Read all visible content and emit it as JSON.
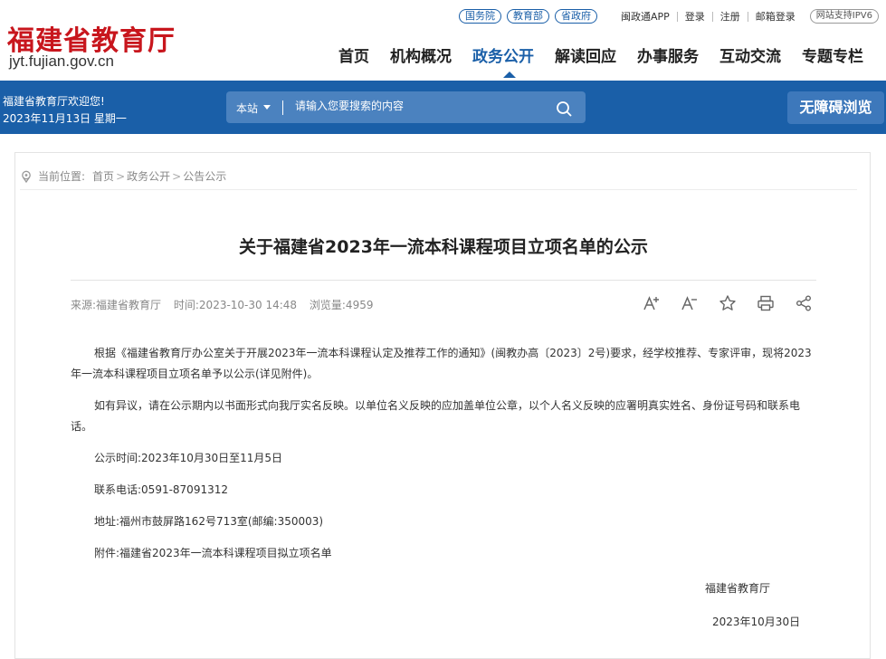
{
  "header": {
    "logo_title": "福建省教育厅",
    "logo_domain": "jyt.fujian.gov.cn",
    "top_pills": [
      "国务院",
      "教育部",
      "省政府"
    ],
    "top_links": [
      "闽政通APP",
      "登录",
      "注册",
      "邮箱登录"
    ],
    "ipv6": "网站支持IPV6",
    "nav": [
      "首页",
      "机构概况",
      "政务公开",
      "解读回应",
      "办事服务",
      "互动交流",
      "专题专栏"
    ],
    "active_nav": "政务公开"
  },
  "band": {
    "welcome": "福建省教育厅欢迎您!",
    "date": "2023年11月13日 星期一",
    "search_scope": "本站",
    "search_placeholder": "请输入您要搜索的内容",
    "accessibility": "无障碍浏览"
  },
  "breadcrumb": {
    "prefix": "当前位置:",
    "items": [
      "首页",
      "政务公开",
      "公告公示"
    ]
  },
  "article": {
    "title": "关于福建省2023年一流本科课程项目立项名单的公示",
    "source": "来源:福建省教育厅",
    "time": "时间:2023-10-30 14:48",
    "views": "浏览量:4959",
    "para1": "根据《福建省教育厅办公室关于开展2023年一流本科课程认定及推荐工作的通知》(闽教办高〔2023〕2号)要求，经学校推荐、专家评审，现将2023年一流本科课程项目立项名单予以公示(详见附件)。",
    "para2": "如有异议，请在公示期内以书面形式向我厅实名反映。以单位名义反映的应加盖单位公章，以个人名义反映的应署明真实姓名、身份证号码和联系电话。",
    "period": "公示时间:2023年10月30日至11月5日",
    "phone": "联系电话:0591-87091312",
    "address": "地址:福州市鼓屏路162号713室(邮编:350003)",
    "attachment": "附件:福建省2023年一流本科课程项目拟立项名单",
    "signature": "福建省教育厅",
    "sign_date": "2023年10月30日"
  },
  "colors": {
    "brand_red": "#c8161d",
    "brand_blue": "#1a5fa8"
  }
}
